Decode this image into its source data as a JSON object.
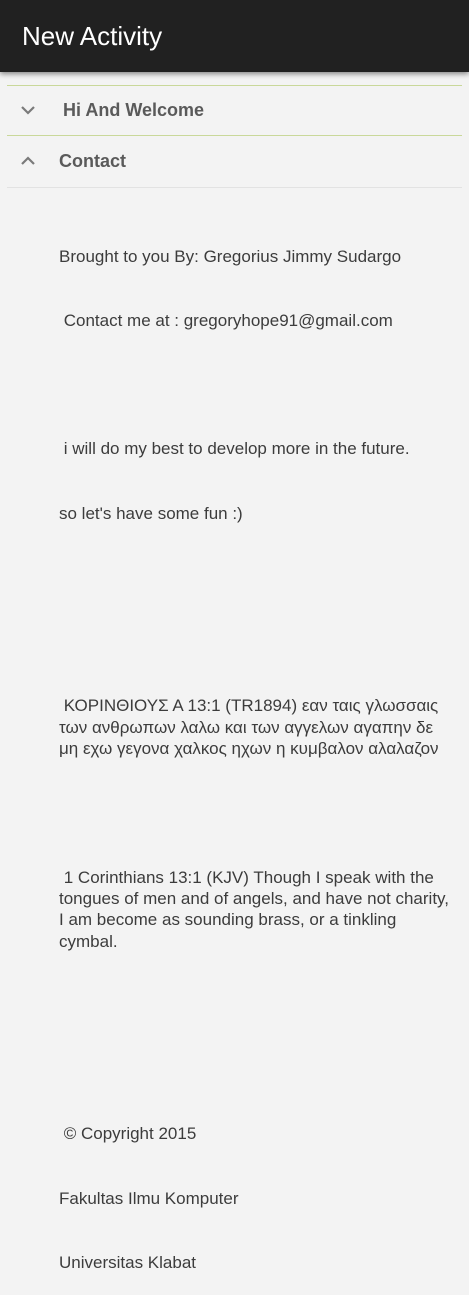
{
  "app": {
    "title": "New Activity"
  },
  "sections": [
    {
      "title": "Hi And Welcome",
      "expanded": false,
      "icon": "chevron-down-icon"
    },
    {
      "title": "Contact",
      "expanded": true,
      "icon": "chevron-up-icon"
    }
  ],
  "contact": {
    "line1": "Brought to you By: Gregorius Jimmy Sudargo",
    "line2": " Contact me at : gregoryhope91@gmail.com",
    "blank1": "",
    "line3": " i will do my best to develop more in the future.",
    "line4": "so let's have some fun :)",
    "blank2": "",
    "blank3": "",
    "greek": " ΚΟΡΙΝΘΙΟΥΣ Α 13:1 (TR1894) εαν ταις γλωσσαις των ανθρωπων λαλω και των αγγελων αγαπην δε μη εχω γεγονα χαλκος ηχων η κυμβαλον αλαλαζον",
    "blank4": "",
    "english": " 1 Corinthians 13:1 (KJV) Though I speak with the tongues of men and of angels, and have not charity, I am become as sounding brass, or a tinkling cymbal.",
    "blank5": "",
    "blank6": "",
    "copyright": " © Copyright 2015",
    "faculty": "Fakultas Ilmu Komputer",
    "university": "Universitas Klabat"
  },
  "colors": {
    "appbar": "#212121",
    "background": "#f3f3f3",
    "divider_accent": "#c9d89a"
  }
}
